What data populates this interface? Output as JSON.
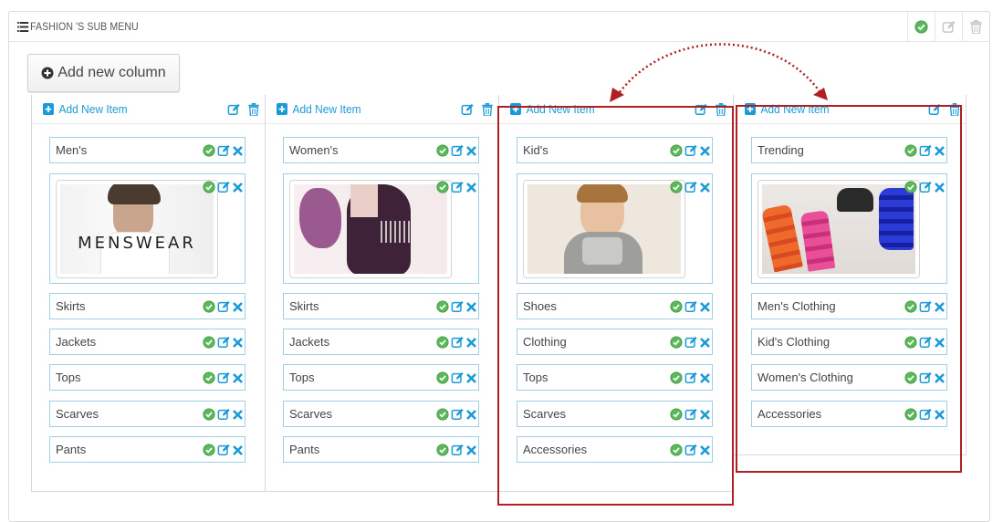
{
  "panel": {
    "title": "FASHION 'S SUB MENU",
    "header_icons": [
      "check-circle-icon",
      "edit-icon",
      "trash-icon"
    ]
  },
  "add_column_button": {
    "label": "Add new column",
    "icon": "plus-circle-icon"
  },
  "columns": [
    {
      "add_item_label": "Add New Item",
      "items": [
        "Men's",
        "Skirts",
        "Jackets",
        "Tops",
        "Scarves",
        "Pants"
      ],
      "image_caption": "MENSWEAR"
    },
    {
      "add_item_label": "Add New Item",
      "items": [
        "Women's",
        "Skirts",
        "Jackets",
        "Tops",
        "Scarves",
        "Pants"
      ]
    },
    {
      "add_item_label": "Add New Item",
      "items": [
        "Kid's",
        "Shoes",
        "Clothing",
        "Tops",
        "Scarves",
        "Accessories"
      ]
    },
    {
      "add_item_label": "Add New Item",
      "items": [
        "Trending",
        "Men's Clothing",
        "Kid's Clothing",
        "Women's Clothing",
        "Accessories"
      ]
    }
  ],
  "colors": {
    "accent": "#1a9bd7",
    "item_border": "#9fcfe6",
    "highlight": "#b01f24",
    "check_green": "#5cb85c"
  }
}
